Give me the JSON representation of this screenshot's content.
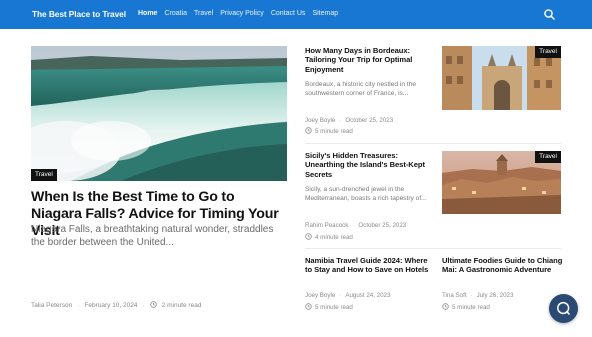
{
  "header": {
    "site_title": "The Best Place to Travel",
    "nav": [
      "Home",
      "Croatia",
      "Travel",
      "Privacy Policy",
      "Contact Us",
      "Sitemap"
    ],
    "search_icon": "search-icon",
    "brand_color": "#1877d2"
  },
  "hero": {
    "category": "Travel",
    "title": "When Is the Best Time to Go to Niagara Falls? Advice for Timing Your Visit",
    "excerpt": "Niagara Falls, a breathtaking natural wonder, straddles the border between the United...",
    "author": "Talia Peterson",
    "date": "February 10, 2024",
    "read_time": "2 minute read"
  },
  "cards": [
    {
      "title": "How Many Days in Bordeaux: Tailoring Your Trip for Optimal Enjoyment",
      "excerpt": "Bordeaux, a historic city nestled in the southwestern corner of France, is...",
      "author": "Joey Boyle",
      "date": "October 25, 2023",
      "read_time": "5 minute read",
      "category": "Travel"
    },
    {
      "title": "Sicily's Hidden Treasures: Unearthing the Island's Best-Kept Secrets",
      "excerpt": "Sicily, a sun-drenched jewel in the Mediterranean, boasts a rich tapestry of...",
      "author": "Rahim Peacock",
      "date": "October 25, 2023",
      "read_time": "4 minute read",
      "category": "Travel"
    },
    {
      "title": "Namibia Travel Guide 2024: Where to Stay and How to Save on Hotels",
      "author": "Joey Boyle",
      "date": "August 24, 2023",
      "read_time": "5 minute read"
    },
    {
      "title": "Ultimate Foodies Guide to Chiang Mai: A Gastronomic Adventure",
      "author": "Tina Soft",
      "date": "July 26, 2023",
      "read_time": "5 minute read"
    }
  ],
  "chat_icon": "chat-bubble-icon"
}
